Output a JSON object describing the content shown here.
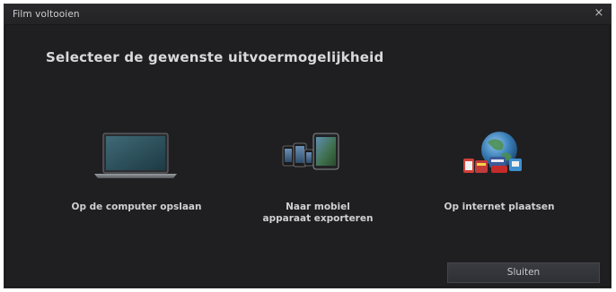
{
  "window": {
    "title": "Film voltooien",
    "close_glyph": "×"
  },
  "main": {
    "heading": "Selecteer de gewenste uitvoermogelijkheid",
    "options": [
      {
        "label": "Op de computer opslaan",
        "icon": "laptop-icon"
      },
      {
        "label": "Naar mobiel\napparaat exporteren",
        "icon": "mobile-devices-icon"
      },
      {
        "label": "Op internet plaatsen",
        "icon": "globe-internet-icon"
      }
    ]
  },
  "footer": {
    "close_label": "Sluiten"
  },
  "colors": {
    "background": "#1f1f21",
    "text": "#d0d0d3",
    "button": "#34353a"
  }
}
